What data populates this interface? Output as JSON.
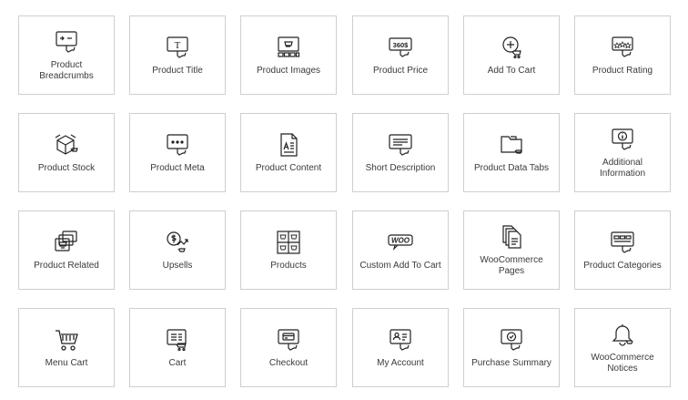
{
  "widgets": [
    {
      "label": "Product Breadcrumbs",
      "icon": "breadcrumb-icon"
    },
    {
      "label": "Product Title",
      "icon": "title-icon"
    },
    {
      "label": "Product Images",
      "icon": "images-icon"
    },
    {
      "label": "Product Price",
      "icon": "price-icon"
    },
    {
      "label": "Add To Cart",
      "icon": "add-to-cart-icon"
    },
    {
      "label": "Product Rating",
      "icon": "rating-icon"
    },
    {
      "label": "Product Stock",
      "icon": "stock-icon"
    },
    {
      "label": "Product Meta",
      "icon": "meta-icon"
    },
    {
      "label": "Product Content",
      "icon": "content-icon"
    },
    {
      "label": "Short Description",
      "icon": "short-description-icon"
    },
    {
      "label": "Product Data Tabs",
      "icon": "data-tabs-icon"
    },
    {
      "label": "Additional Information",
      "icon": "info-icon"
    },
    {
      "label": "Product Related",
      "icon": "related-icon"
    },
    {
      "label": "Upsells",
      "icon": "upsells-icon"
    },
    {
      "label": "Products",
      "icon": "products-grid-icon"
    },
    {
      "label": "Custom Add To Cart",
      "icon": "woo-badge-icon"
    },
    {
      "label": "WooCommerce Pages",
      "icon": "pages-icon"
    },
    {
      "label": "Product Categories",
      "icon": "categories-icon"
    },
    {
      "label": "Menu Cart",
      "icon": "cart-icon"
    },
    {
      "label": "Cart",
      "icon": "cart-list-icon"
    },
    {
      "label": "Checkout",
      "icon": "checkout-card-icon"
    },
    {
      "label": "My Account",
      "icon": "account-icon"
    },
    {
      "label": "Purchase Summary",
      "icon": "summary-check-icon"
    },
    {
      "label": "WooCommerce Notices",
      "icon": "bell-icon"
    }
  ],
  "icon_text": {
    "price": "360$",
    "woo": "WOO",
    "title": "T"
  }
}
